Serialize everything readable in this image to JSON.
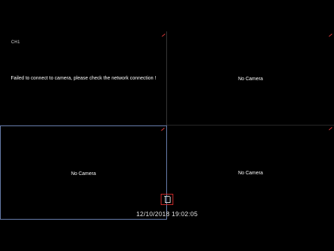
{
  "viewer": {
    "panes": [
      {
        "channel_label": "CH1",
        "message": "Failed to connect to camera, please check the network connection !"
      },
      {
        "channel_label": "",
        "message": "No Camera"
      },
      {
        "channel_label": "",
        "message": "No Camera"
      },
      {
        "channel_label": "",
        "message": "No Camera"
      }
    ],
    "timestamp": "12/10/2018 19:02:05",
    "icons": {
      "record_indicator": "record-indicator-icon",
      "center_control": "delete-icon"
    },
    "colors": {
      "background": "#000000",
      "selected_border": "#6f86b8",
      "indicator_red": "#e23a3a"
    }
  }
}
